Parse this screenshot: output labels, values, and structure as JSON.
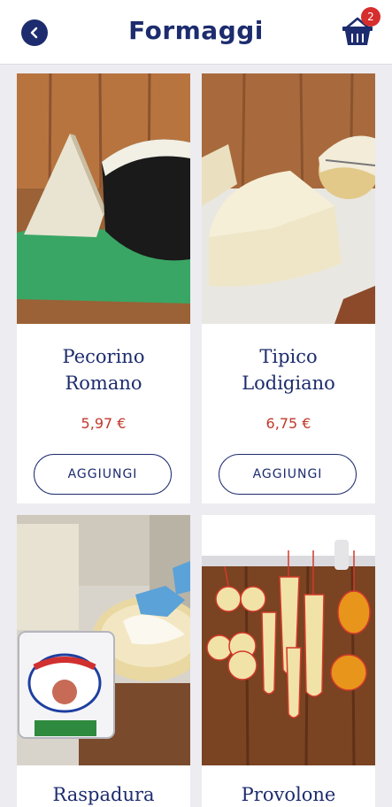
{
  "header": {
    "title": "Formaggi",
    "cart_count": "2"
  },
  "products": [
    {
      "name_line1": "Pecorino",
      "name_line2": "Romano",
      "price": "5,97 €",
      "button": "AGGIUNGI"
    },
    {
      "name_line1": "Tipico",
      "name_line2": "Lodigiano",
      "price": "6,75 €",
      "button": "AGGIUNGI"
    },
    {
      "name_line1": "Raspadura"
    },
    {
      "name_line1": "Provolone"
    }
  ],
  "colors": {
    "primary": "#1d2c6e",
    "price": "#c0392b",
    "badge": "#d62d2d",
    "background": "#ececf1"
  }
}
